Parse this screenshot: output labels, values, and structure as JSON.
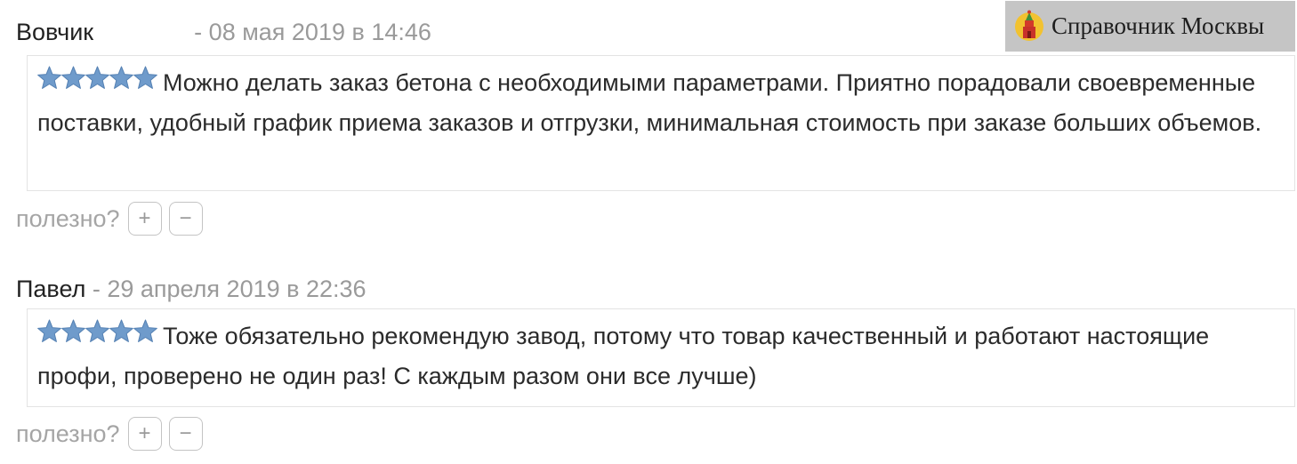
{
  "brand": {
    "title": "Справочник Москвы",
    "logo_icon": "kremlin-tower-icon"
  },
  "reviews": [
    {
      "author": "Вовчик",
      "separator": "-",
      "date": "08 мая 2019 в 14:46",
      "rating": 5,
      "rating_max": 5,
      "text": "Можно делать заказ бетона с необходимыми параметрами. Приятно порадовали своевременные поставки, удобный график приема заказов и отгрузки, минимальная стоимость при заказе больших объемов.",
      "useful_label": "полезно?",
      "plus_label": "+",
      "minus_label": "−"
    },
    {
      "author": "Павел",
      "separator": "-",
      "date": "29 апреля 2019 в 22:36",
      "rating": 5,
      "rating_max": 5,
      "text": "Тоже обязательно рекомендую завод, потому что товар качественный и работают настоящие профи, проверено не один раз! С каждым разом они все лучше)",
      "useful_label": "полезно?",
      "plus_label": "+",
      "minus_label": "−"
    }
  ],
  "colors": {
    "star_fill": "#6f9bcb",
    "star_stroke": "#5581b3",
    "date_text": "#9a9a9a",
    "badge_background": "#c5c5c5"
  }
}
